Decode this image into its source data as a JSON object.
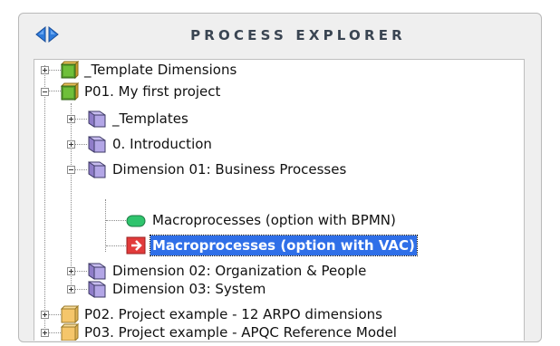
{
  "header": {
    "title": "PROCESS EXPLORER"
  },
  "tree": {
    "items": [
      {
        "label": "_Template Dimensions"
      },
      {
        "label": "P01. My first project"
      },
      {
        "label": "_Templates"
      },
      {
        "label": "0. Introduction"
      },
      {
        "label": "Dimension 01: Business Processes"
      },
      {
        "label": "Macroprocesses (option with BPMN)"
      },
      {
        "label": "Macroprocesses (option with VAC)"
      },
      {
        "label": "Dimension 02: Organization & People"
      },
      {
        "label": "Dimension 03: System"
      },
      {
        "label": "P02. Project example - 12 ARPO dimensions"
      },
      {
        "label": "P03. Project example - APQC Reference Model"
      }
    ]
  },
  "colors": {
    "accent": "#2e7bdc",
    "selection": "#2f6fe8",
    "project_active": "#5aa02c",
    "project_inactive": "#f5c66b",
    "bpmn_icon": "#2fc46d",
    "vac_icon": "#e23b3b",
    "folder": "#a894d8"
  },
  "icons": {
    "back": "triangle-left-icon",
    "forward": "triangle-right-icon",
    "project": "project-cube-icon",
    "folder": "folder-icon",
    "bpmn": "bpmn-process-icon",
    "vac": "vac-chevron-icon"
  }
}
